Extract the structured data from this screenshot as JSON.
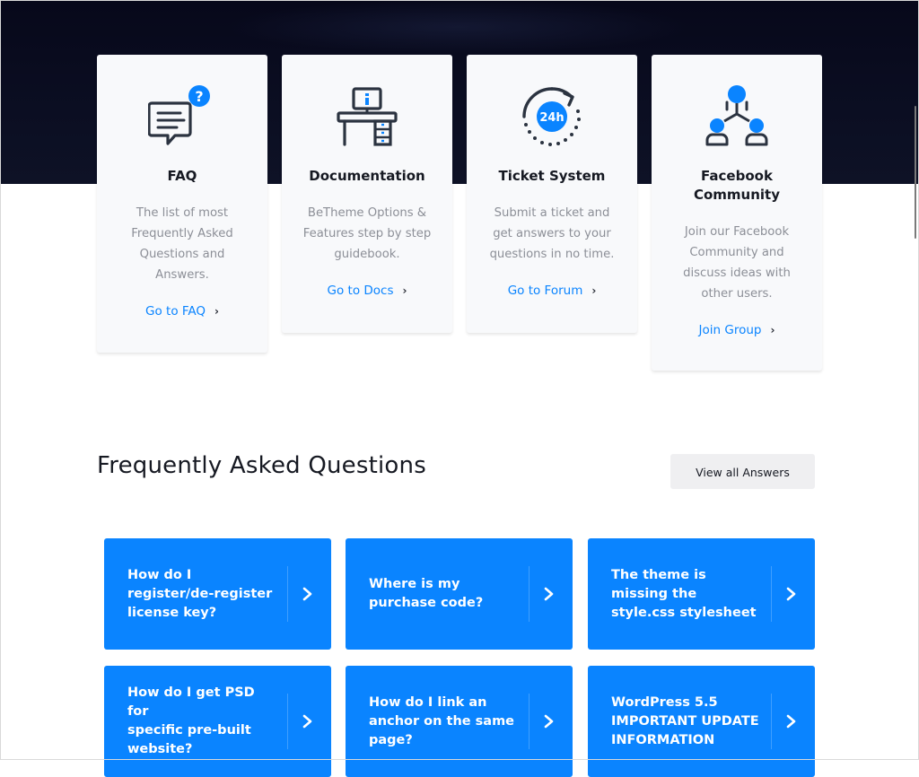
{
  "cards": [
    {
      "title": "FAQ",
      "desc": [
        "The list of most",
        "Frequently Asked",
        "Questions and",
        "Answers."
      ],
      "link": "Go to FAQ",
      "icon": "faq-chat-question-icon"
    },
    {
      "title": "Documentation",
      "desc": [
        "BeTheme Options &",
        "Features step by step",
        "guidebook."
      ],
      "link": "Go to Docs",
      "icon": "desk-documentation-icon"
    },
    {
      "title": "Ticket System",
      "desc": [
        "Submit a ticket and",
        "get answers to your",
        "questions in no time."
      ],
      "link": "Go to Forum",
      "icon": "clock-24h-icon",
      "badge": "24h"
    },
    {
      "title_lines": [
        "Facebook",
        "Community"
      ],
      "desc": [
        "Join our Facebook",
        "Community and",
        "discuss ideas with",
        "other users."
      ],
      "link": "Join Group",
      "icon": "community-network-icon"
    }
  ],
  "faq": {
    "title": "Frequently Asked Questions",
    "view_all": "View all Answers",
    "questions": [
      {
        "lines": [
          "How do I",
          "register/de-register",
          "license key?"
        ]
      },
      {
        "lines": [
          "Where is my",
          "purchase code?"
        ]
      },
      {
        "lines": [
          "The theme is",
          "missing the",
          "style.css stylesheet"
        ]
      },
      {
        "lines": [
          "How do I get PSD for",
          "specific pre-built",
          "website?"
        ]
      },
      {
        "lines": [
          "How do I link an",
          "anchor on the same",
          "page?"
        ]
      },
      {
        "lines": [
          "WordPress 5.5",
          "IMPORTANT UPDATE",
          "INFORMATION"
        ]
      }
    ]
  },
  "icons": {
    "faq_badge": "?"
  },
  "colors": {
    "accent": "#0a84ff",
    "dark": "#161922",
    "hero": "#0b0e22",
    "icon_stroke": "#2b3340"
  }
}
